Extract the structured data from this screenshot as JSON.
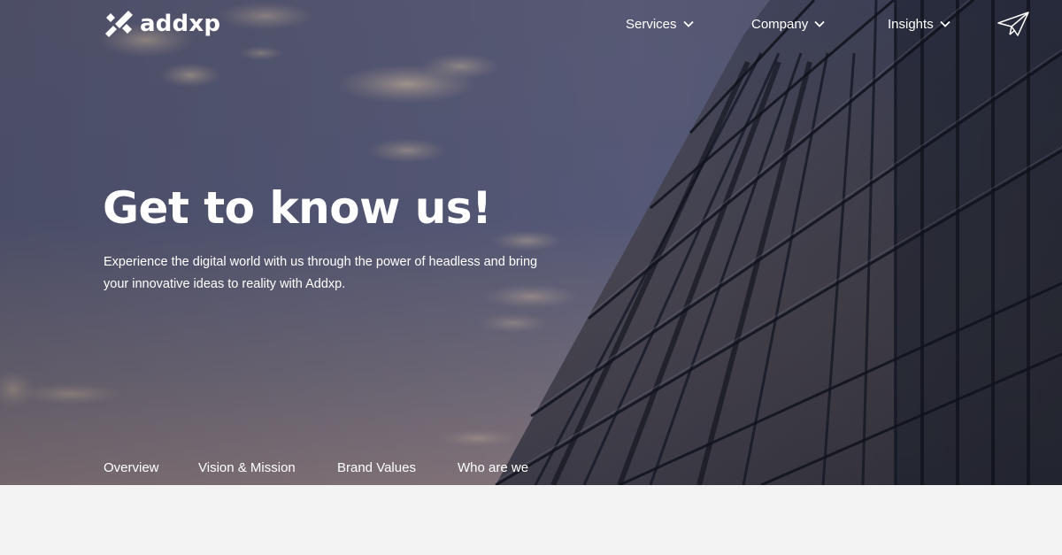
{
  "brand": {
    "name": "addxp"
  },
  "header": {
    "nav": [
      {
        "label": "Services"
      },
      {
        "label": "Company"
      },
      {
        "label": "Insights"
      }
    ],
    "contact_icon": "paper-plane-icon",
    "chevron_icon": "chevron-down-icon"
  },
  "hero": {
    "title": "Get to know us!",
    "description": "Experience the digital world with us through the power of headless and bring your innovative ideas to reality with Addxp."
  },
  "subnav": [
    {
      "label": "Overview"
    },
    {
      "label": "Vision & Mission"
    },
    {
      "label": "Brand Values"
    },
    {
      "label": "Who are we"
    }
  ],
  "colors": {
    "text": "#ffffff",
    "sky_top": "#5a5f7f",
    "sky_bottom": "#8f7f86",
    "building_glass": "#232838",
    "below_section": "#f3f3f3"
  }
}
